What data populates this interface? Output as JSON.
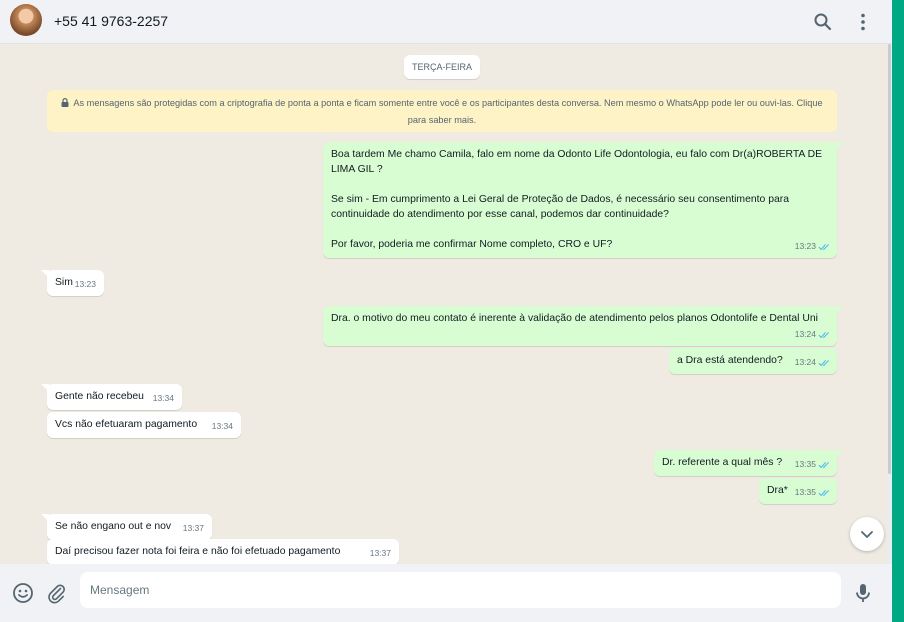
{
  "header": {
    "contact_name": "+55 41 9763-2257",
    "icons": [
      "avatar",
      "search-icon",
      "menu-icon"
    ]
  },
  "chat": {
    "day_label": "TERÇA-FEIRA",
    "encryption_notice": "As mensagens são protegidas com a criptografia de ponta a ponta e ficam somente entre você e os participantes desta conversa. Nem mesmo o WhatsApp pode ler ou ouvi-las. Clique para saber mais.",
    "messages": [
      {
        "dir": "out",
        "text": "Boa tardem Me chamo Camila, falo em nome da Odonto Life Odontologia, eu falo com Dr(a)ROBERTA DE LIMA GIL ?\n\nSe sim - Em cumprimento a Lei Geral de Proteção de Dados, é necessário seu consentimento para continuidade do atendimento por esse canal, podemos dar continuidade?\n\nPor favor, poderia me confirmar Nome completo, CRO e UF?",
        "time": "13:23",
        "status": "read"
      },
      {
        "dir": "in",
        "text": "Sim",
        "time": "13:23"
      },
      {
        "dir": "out",
        "text": "Dra. o motivo do meu contato é inerente à validação de atendimento pelos planos Odontolife e Dental Uni",
        "time": "13:24",
        "status": "read"
      },
      {
        "dir": "out",
        "text": "a Dra está atendendo?",
        "time": "13:24",
        "status": "read"
      },
      {
        "dir": "in",
        "text": "Gente não recebeu",
        "time": "13:34"
      },
      {
        "dir": "in",
        "text": "Vcs não efetuaram pagamento",
        "time": "13:34"
      },
      {
        "dir": "out",
        "text": "Dr. referente a qual mês ?",
        "time": "13:35",
        "status": "read"
      },
      {
        "dir": "out",
        "text": "Dra*",
        "time": "13:35",
        "status": "read"
      },
      {
        "dir": "in",
        "text": "Se não engano out e nov",
        "time": "13:37"
      },
      {
        "dir": "in",
        "text": "Daí precisou fazer nota foi feira e não foi efetuado pagamento",
        "time": "13:37"
      }
    ]
  },
  "footer": {
    "input_placeholder": "Mensagem",
    "input_value": "",
    "icons": [
      "emoji-icon",
      "attach-icon",
      "mic-icon"
    ]
  },
  "colors": {
    "outgoing_bubble": "#d9fdd3",
    "incoming_bubble": "#ffffff",
    "chat_background": "#efeae2",
    "header_background": "#f0f2f5",
    "accent": "#00a884",
    "notice_background": "#fdf3c6"
  }
}
